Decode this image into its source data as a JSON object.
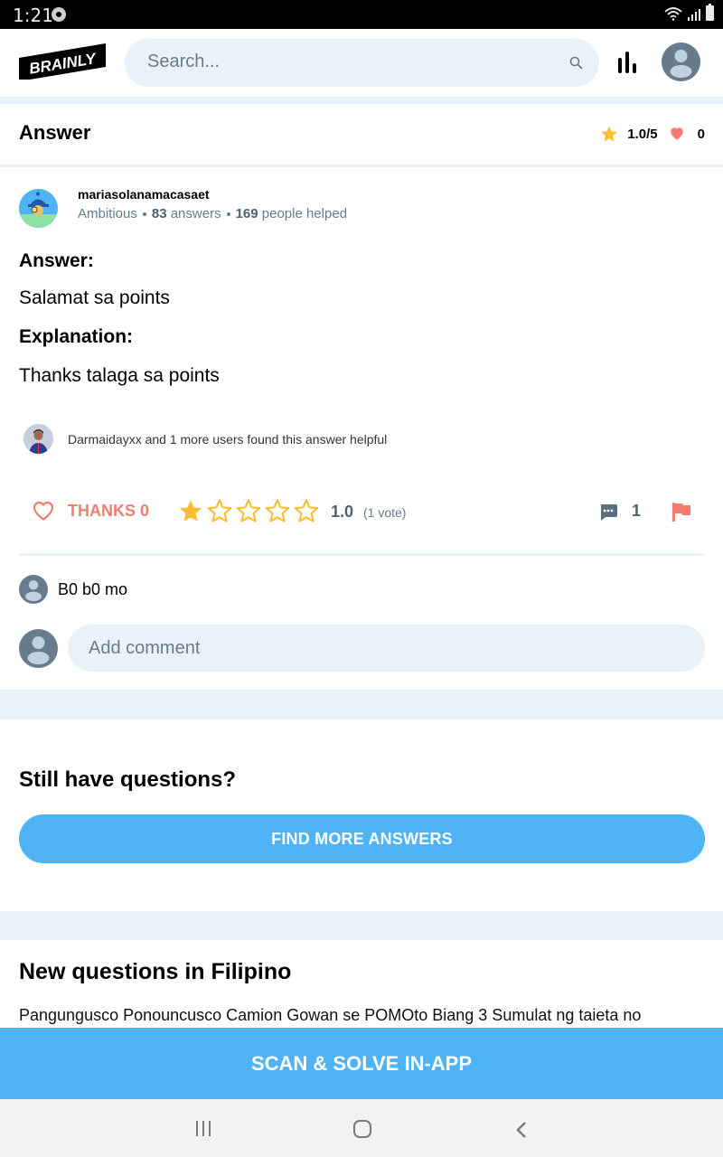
{
  "status_bar": {
    "time": "1:21"
  },
  "header": {
    "logo_text": "BRAINLY",
    "search_placeholder": "Search..."
  },
  "answer_header": {
    "title": "Answer",
    "rating": "1.0/5",
    "likes": "0"
  },
  "author": {
    "name": "mariasolanamacasaet",
    "rank": "Ambitious",
    "answers_count": "83",
    "answers_label": "answers",
    "helped_count": "169",
    "helped_label": "people helped"
  },
  "answer": {
    "answer_label": "Answer:",
    "answer_text": "Salamat sa points",
    "explanation_label": "Explanation:",
    "explanation_text": "Thanks talaga sa points"
  },
  "helpful": {
    "text": "Darmaidayxx and 1 more users found this answer helpful"
  },
  "actions": {
    "thanks_label": "THANKS 0",
    "rating_value": "1.0",
    "rating_filled_stars": 1,
    "rating_max_stars": 5,
    "vote_count": "(1 vote)",
    "comment_count": "1"
  },
  "comments": [
    {
      "text": "B0 b0 mo"
    }
  ],
  "add_comment": {
    "placeholder": "Add comment"
  },
  "still_have_questions": {
    "heading": "Still have questions?",
    "button_label": "FIND MORE ANSWERS"
  },
  "new_questions": {
    "heading": "New questions in Filipino",
    "items": [
      {
        "text": "Pangungusco Ponouncusco Camion Gowan se POMOto Biang 3 Sumulat ng taieta no"
      }
    ]
  },
  "cta": {
    "label": "SCAN & SOLVE IN-APP"
  },
  "colors": {
    "accent_blue": "#4fb3f6",
    "thanks_red": "#ef7f6f",
    "star_yellow": "#fbbe2e",
    "muted_gray": "#687b8c",
    "background_light": "#ebf2f7"
  }
}
